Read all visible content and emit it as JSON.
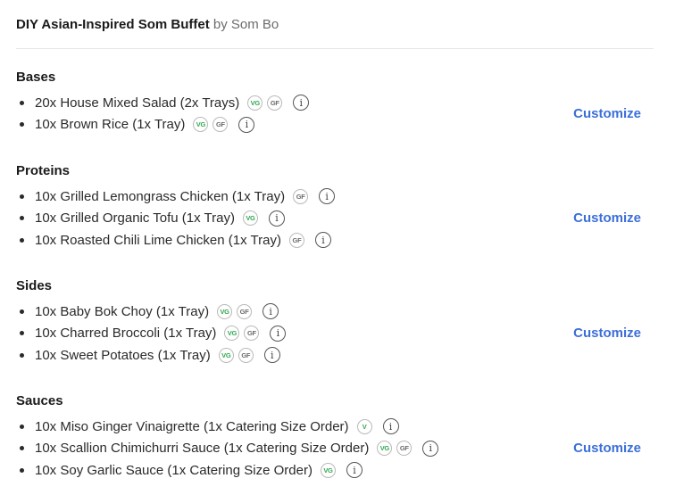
{
  "header": {
    "title": "DIY Asian-Inspired Som Buffet",
    "byline": "by Som Bo"
  },
  "customize_label": "Customize",
  "info_glyph": "i",
  "sections": [
    {
      "title": "Bases",
      "items": [
        {
          "label": "20x House Mixed Salad (2x Trays)",
          "tags": [
            "VG",
            "GF"
          ]
        },
        {
          "label": "10x Brown Rice (1x Tray)",
          "tags": [
            "VG",
            "GF"
          ]
        }
      ]
    },
    {
      "title": "Proteins",
      "items": [
        {
          "label": "10x Grilled Lemongrass Chicken (1x Tray)",
          "tags": [
            "GF"
          ]
        },
        {
          "label": "10x Grilled Organic Tofu (1x Tray)",
          "tags": [
            "VG"
          ]
        },
        {
          "label": "10x Roasted Chili Lime Chicken (1x Tray)",
          "tags": [
            "GF"
          ]
        }
      ]
    },
    {
      "title": "Sides",
      "items": [
        {
          "label": "10x Baby Bok Choy (1x Tray)",
          "tags": [
            "VG",
            "GF"
          ]
        },
        {
          "label": "10x Charred Broccoli (1x Tray)",
          "tags": [
            "VG",
            "GF"
          ]
        },
        {
          "label": "10x Sweet Potatoes (1x Tray)",
          "tags": [
            "VG",
            "GF"
          ]
        }
      ]
    },
    {
      "title": "Sauces",
      "items": [
        {
          "label": "10x Miso Ginger Vinaigrette (1x Catering Size Order)",
          "tags": [
            "V"
          ]
        },
        {
          "label": "10x Scallion Chimichurri Sauce (1x Catering Size Order)",
          "tags": [
            "VG",
            "GF"
          ]
        },
        {
          "label": "10x Soy Garlic Sauce (1x Catering Size Order)",
          "tags": [
            "VG"
          ]
        }
      ]
    }
  ],
  "colors": {
    "accent": "#3b6fd8",
    "vegan_tag": "#2fa84f",
    "gf_tag": "#6b6b6b"
  }
}
